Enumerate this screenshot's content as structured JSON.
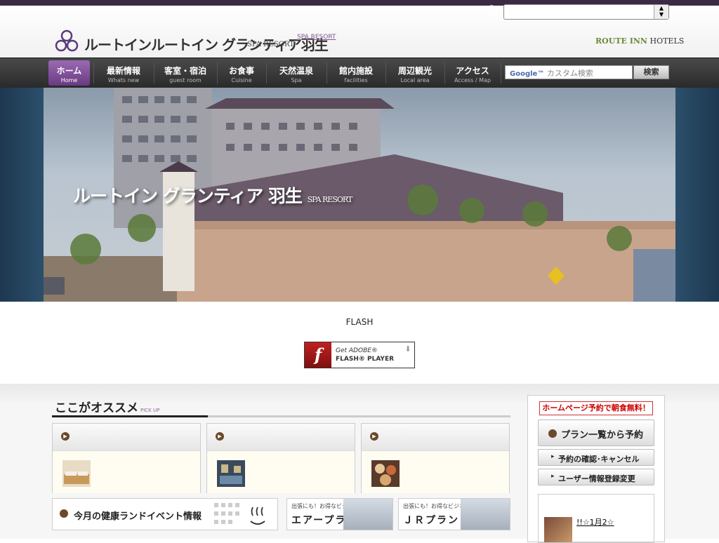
{
  "header": {
    "logo_text": "ルートインルートイン グランティア羽生",
    "logo_sub": "SPA RESORT",
    "desc_line1": "",
    "desc_line2": "SPA RESORT",
    "brand": "ROUTE INN HOTELS",
    "hotel_select_value": ""
  },
  "nav": {
    "items": [
      {
        "jp": "ホーム",
        "en": "Home"
      },
      {
        "jp": "最新情報",
        "en": "Whats new"
      },
      {
        "jp": "客室・宿泊",
        "en": "guest room"
      },
      {
        "jp": "お食事",
        "en": "Cuisine"
      },
      {
        "jp": "天然温泉",
        "en": "Spa"
      },
      {
        "jp": "館内施設",
        "en": "facilities"
      },
      {
        "jp": "周辺観光",
        "en": "Local area"
      },
      {
        "jp": "アクセス",
        "en": "Access / Map"
      }
    ],
    "search_google": "Google™",
    "search_placeholder": "カスタム検索",
    "search_button": "検索"
  },
  "hero": {
    "title": "ルートイン グランティア 羽生",
    "title_sub": "SPA RESORT"
  },
  "flash": {
    "message_line1": "FLASH",
    "message_line2": "",
    "btn_line1": "Get ADOBE®",
    "btn_line2": "FLASH® PLAYER"
  },
  "pickup": {
    "title": "ここがオススメ",
    "title_en": "PICK UP",
    "cards": [
      {
        "title": "",
        "text": ""
      },
      {
        "title": "",
        "text": ""
      },
      {
        "title": "",
        "text": ""
      }
    ],
    "banners": [
      {
        "text": "今月の健康ランドイベント情報"
      },
      {
        "small": "出張にも！お得なビジネスプラン",
        "big": "エアープラン"
      },
      {
        "small": "出張にも！お得なビジネスプラン",
        "big": "ＪＲプラン"
      }
    ]
  },
  "sidebar": {
    "promo": "ホームページ予約で朝食無料！",
    "plan_btn": "プラン一覧から予約",
    "confirm_btn": "予約の確認･キャンセル",
    "user_btn": "ユーザー情報登録変更",
    "news_head": "",
    "news_text": "!!☆1月2☆"
  },
  "colors": {
    "accent": "#7a4a92",
    "dark": "#3a2a44",
    "promo_red": "#cc0000"
  }
}
